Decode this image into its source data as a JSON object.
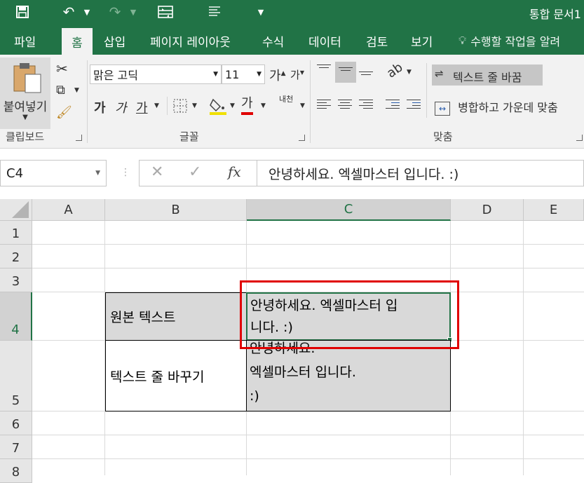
{
  "title_bar": {
    "document_title": "통합 문서1"
  },
  "ribbon_tabs": [
    "파일",
    "홈",
    "삽입",
    "페이지 레이아웃",
    "수식",
    "데이터",
    "검토",
    "보기"
  ],
  "tell_me": "수행할 작업을 알려",
  "clipboard": {
    "paste_label": "붙여넣기",
    "group_label": "클립보드"
  },
  "font": {
    "family": "맑은 고딕",
    "size": "11",
    "grow": "가",
    "shrink": "가",
    "bold": "가",
    "italic": "가",
    "underline": "가",
    "font_color_glyph": "가",
    "phonetic": "내천",
    "group_label": "글꼴"
  },
  "alignment": {
    "wrap_text": "텍스트 줄 바꿈",
    "merge_center": "병합하고 가운데 맞춤",
    "group_label": "맞춤"
  },
  "formula_bar": {
    "name_box": "C4",
    "fx": "fx",
    "formula": "안녕하세요. 엑셀마스터 입니다. :)"
  },
  "columns": [
    "A",
    "B",
    "C",
    "D",
    "E"
  ],
  "rows": [
    "1",
    "2",
    "3",
    "4",
    "5",
    "6",
    "7",
    "8"
  ],
  "cells": {
    "B4": "원본 텍스트",
    "C4_line1": "안녕하세요. 엑셀마스터 입",
    "C4_line2": "니다. :)",
    "B5": "텍스트 줄 바꾸기",
    "C5_line1": "안녕하세요.",
    "C5_line2": "엑셀마스터 입니다.",
    "C5_line3": ":)"
  },
  "colors": {
    "excel_green": "#217346",
    "highlight_red": "#e00000",
    "cell_fill": "#d9d9d9"
  }
}
